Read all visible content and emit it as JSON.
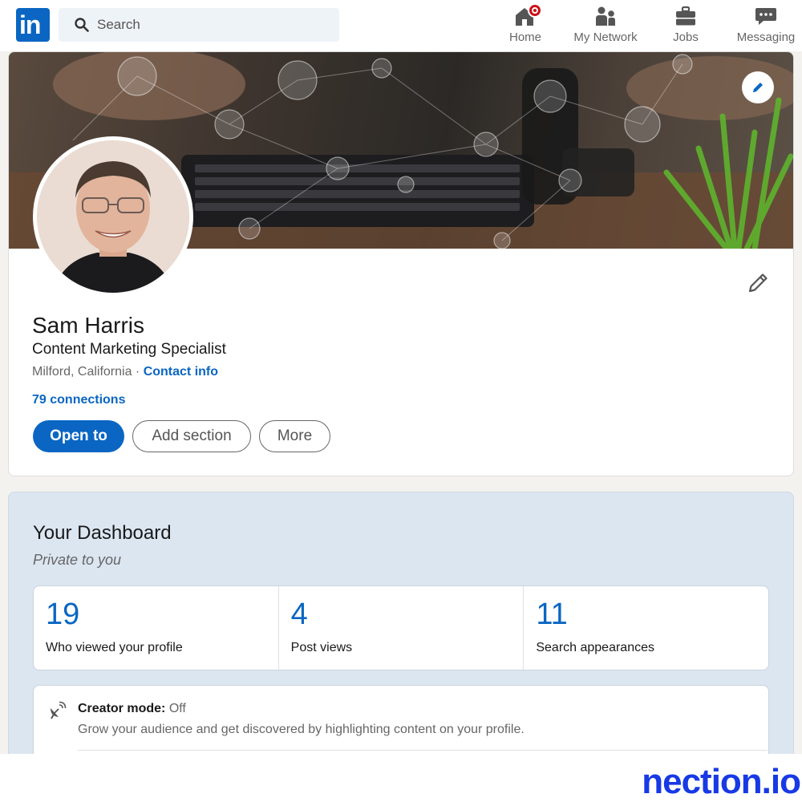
{
  "nav": {
    "logo": "in",
    "search_placeholder": "Search",
    "items": [
      {
        "label": "Home",
        "icon": "home-icon"
      },
      {
        "label": "My Network",
        "icon": "people-icon"
      },
      {
        "label": "Jobs",
        "icon": "briefcase-icon"
      },
      {
        "label": "Messaging",
        "icon": "chat-icon"
      }
    ]
  },
  "profile": {
    "name": "Sam Harris",
    "headline": "Content Marketing Specialist",
    "location": "Milford, California",
    "separator": " · ",
    "contact_label": "Contact info",
    "connections": "79 connections",
    "buttons": {
      "open_to": "Open to",
      "add_section": "Add section",
      "more": "More"
    }
  },
  "dashboard": {
    "title": "Your Dashboard",
    "subtitle": "Private to you",
    "stats": [
      {
        "value": "19",
        "label": "Who viewed your profile"
      },
      {
        "value": "4",
        "label": "Post views"
      },
      {
        "value": "11",
        "label": "Search appearances"
      }
    ],
    "creator": {
      "title": "Creator mode:",
      "status": "Off",
      "description": "Grow your audience and get discovered by highlighting content on your profile."
    }
  },
  "watermark": "nection.io",
  "colors": {
    "brand_blue": "#0a66c2",
    "notification_red": "#cc1016",
    "dashboard_bg": "#dce6f1",
    "watermark_blue": "#1739e6"
  }
}
